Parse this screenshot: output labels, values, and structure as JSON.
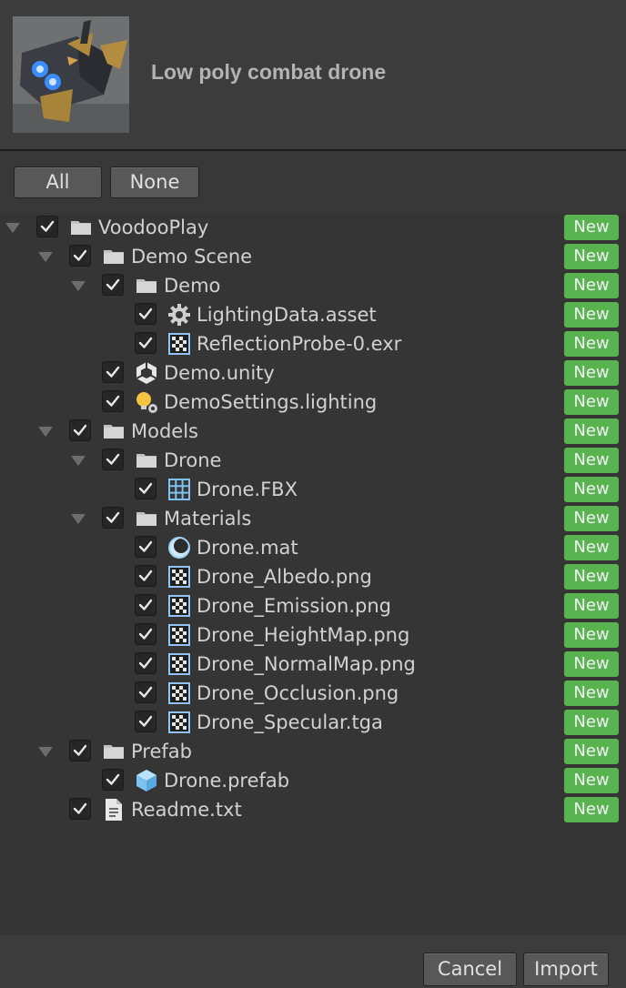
{
  "package": {
    "title": "Low poly combat drone",
    "thumbnail_icon": "drone-thumbnail"
  },
  "toolbar": {
    "all_label": "All",
    "none_label": "None"
  },
  "badge_label": "New",
  "colors": {
    "badge": "#58b450",
    "background": "#383838",
    "panel": "#353535",
    "accent_blue": "#7fc1f0",
    "lighting_yellow": "#f5c242"
  },
  "tree": [
    {
      "label": "VoodooPlay",
      "depth": 0,
      "expanded": true,
      "icon": "folder-icon",
      "checked": true,
      "status": "New"
    },
    {
      "label": "Demo Scene",
      "depth": 1,
      "expanded": true,
      "icon": "folder-icon",
      "checked": true,
      "status": "New"
    },
    {
      "label": "Demo",
      "depth": 2,
      "expanded": true,
      "icon": "folder-icon",
      "checked": true,
      "status": "New"
    },
    {
      "label": "LightingData.asset",
      "depth": 3,
      "icon": "gear-icon",
      "checked": true,
      "status": "New"
    },
    {
      "label": "ReflectionProbe-0.exr",
      "depth": 3,
      "icon": "texture-icon",
      "checked": true,
      "status": "New"
    },
    {
      "label": "Demo.unity",
      "depth": 2,
      "icon": "unity-scene-icon",
      "checked": true,
      "status": "New"
    },
    {
      "label": "DemoSettings.lighting",
      "depth": 2,
      "icon": "lighting-settings-icon",
      "checked": true,
      "status": "New"
    },
    {
      "label": "Models",
      "depth": 1,
      "expanded": true,
      "icon": "folder-icon",
      "checked": true,
      "status": "New"
    },
    {
      "label": "Drone",
      "depth": 2,
      "expanded": true,
      "icon": "folder-icon",
      "checked": true,
      "status": "New"
    },
    {
      "label": "Drone.FBX",
      "depth": 3,
      "icon": "mesh-grid-icon",
      "checked": true,
      "status": "New"
    },
    {
      "label": "Materials",
      "depth": 2,
      "expanded": true,
      "icon": "folder-icon",
      "checked": true,
      "status": "New"
    },
    {
      "label": "Drone.mat",
      "depth": 3,
      "icon": "material-sphere-icon",
      "checked": true,
      "status": "New"
    },
    {
      "label": "Drone_Albedo.png",
      "depth": 3,
      "icon": "texture-icon",
      "checked": true,
      "status": "New"
    },
    {
      "label": "Drone_Emission.png",
      "depth": 3,
      "icon": "texture-icon",
      "checked": true,
      "status": "New"
    },
    {
      "label": "Drone_HeightMap.png",
      "depth": 3,
      "icon": "texture-icon",
      "checked": true,
      "status": "New"
    },
    {
      "label": "Drone_NormalMap.png",
      "depth": 3,
      "icon": "texture-icon",
      "checked": true,
      "status": "New"
    },
    {
      "label": "Drone_Occlusion.png",
      "depth": 3,
      "icon": "texture-icon",
      "checked": true,
      "status": "New"
    },
    {
      "label": "Drone_Specular.tga",
      "depth": 3,
      "icon": "texture-icon",
      "checked": true,
      "status": "New"
    },
    {
      "label": "Prefab",
      "depth": 1,
      "expanded": true,
      "icon": "folder-icon",
      "checked": true,
      "status": "New"
    },
    {
      "label": "Drone.prefab",
      "depth": 2,
      "icon": "prefab-cube-icon",
      "checked": true,
      "status": "New"
    },
    {
      "label": "Readme.txt",
      "depth": 1,
      "icon": "text-file-icon",
      "checked": true,
      "status": "New"
    }
  ],
  "footer": {
    "cancel_label": "Cancel",
    "import_label": "Import"
  }
}
